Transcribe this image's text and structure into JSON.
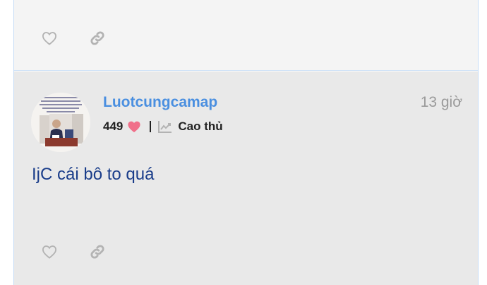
{
  "previous_post": {
    "like_icon": "heart-outline-icon",
    "link_icon": "link-icon"
  },
  "post": {
    "username": "Luotcungcamap",
    "time": "13 giờ",
    "likes_count": "449",
    "rank": "Cao thủ",
    "body": "IjC cái bô to quá",
    "like_icon": "heart-outline-icon",
    "link_icon": "link-icon"
  },
  "colors": {
    "accent": "#4a8fe0",
    "heart": "#f0708a",
    "body_text": "#1a3d8a",
    "icon_gray": "#b3b3b3"
  }
}
